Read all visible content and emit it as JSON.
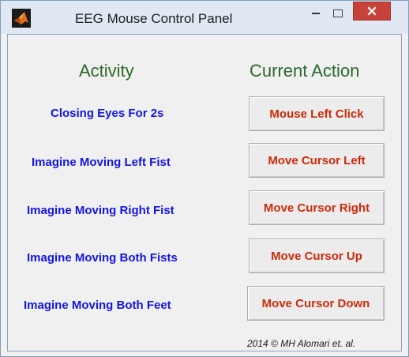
{
  "window": {
    "title": "EEG Mouse Control Panel",
    "close_color": "#c7433a"
  },
  "headers": {
    "activity": "Activity",
    "current_action": "Current Action"
  },
  "rows": [
    {
      "activity": "Closing Eyes For 2s",
      "action": "Mouse Left Click"
    },
    {
      "activity": "Imagine Moving Left Fist",
      "action": "Move Cursor Left"
    },
    {
      "activity": "Imagine Moving Right Fist",
      "action": "Move Cursor Right"
    },
    {
      "activity": "Imagine Moving Both Fists",
      "action": "Move Cursor Up"
    },
    {
      "activity": "Imagine Moving Both Feet",
      "action": "Move Cursor Down"
    }
  ],
  "footer": "2014 © MH Alomari et. al.",
  "colors": {
    "header_text": "#2a6a2a",
    "activity_text": "#1414e6",
    "action_text": "#cc2a0a"
  },
  "icons": {
    "app": "matlab-logo-icon",
    "minimize": "minimize-icon",
    "maximize": "maximize-icon",
    "close": "close-icon"
  }
}
